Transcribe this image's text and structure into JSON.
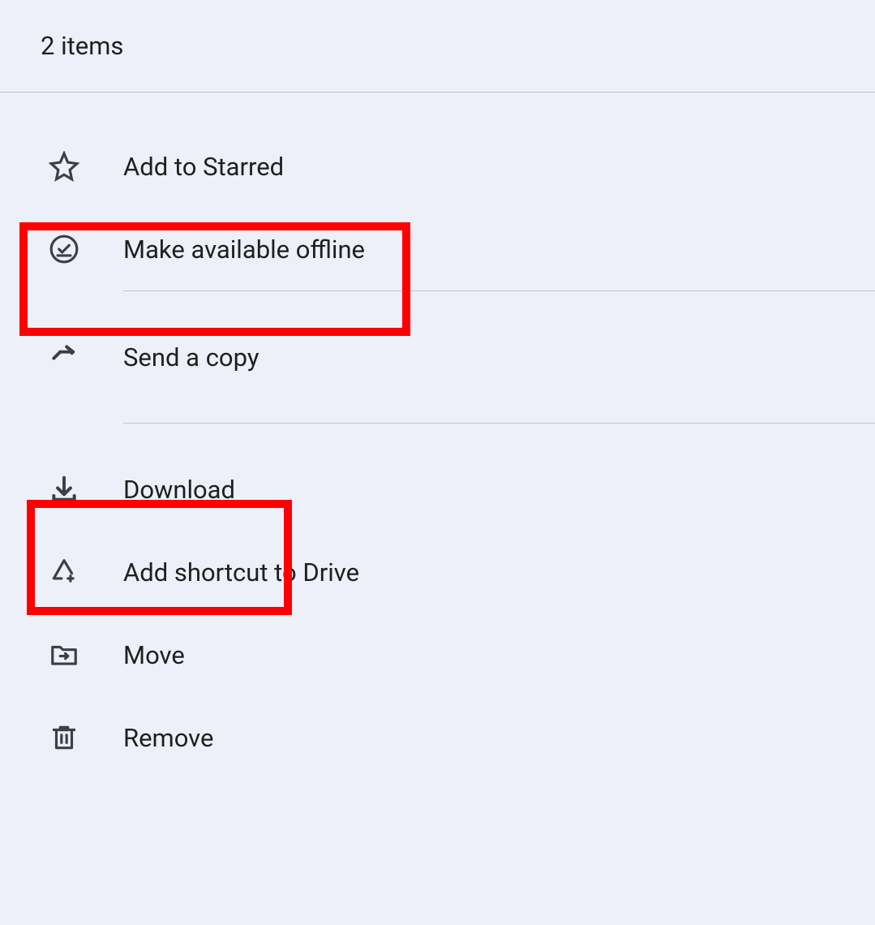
{
  "header": {
    "title": "2 items"
  },
  "menu": {
    "items": [
      {
        "label": "Add to Starred",
        "icon": "star-icon"
      },
      {
        "label": "Make available offline",
        "icon": "offline-icon"
      },
      {
        "label": "Send a copy",
        "icon": "send-icon"
      },
      {
        "label": "Download",
        "icon": "download-icon"
      },
      {
        "label": "Add shortcut to Drive",
        "icon": "shortcut-icon"
      },
      {
        "label": "Move",
        "icon": "move-icon"
      },
      {
        "label": "Remove",
        "icon": "trash-icon"
      }
    ]
  },
  "highlights": [
    {
      "item": "Make available offline"
    },
    {
      "item": "Download"
    }
  ]
}
